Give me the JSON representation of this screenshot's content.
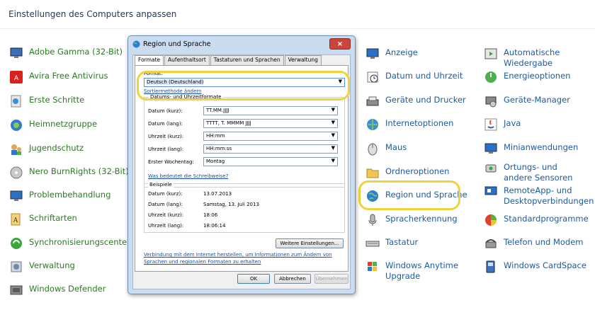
{
  "page_title": "Einstellungen des Computers anpassen",
  "left_column": [
    {
      "label": "Adobe Gamma (32-Bit)",
      "icon": "adobe-gamma-icon",
      "color": "green"
    },
    {
      "label": "Avira Free Antivirus",
      "icon": "avira-icon",
      "color": "green"
    },
    {
      "label": "Erste Schritte",
      "icon": "getting-started-icon",
      "color": "green"
    },
    {
      "label": "Heimnetzgruppe",
      "icon": "homegroup-icon",
      "color": "green"
    },
    {
      "label": "Jugendschutz",
      "icon": "parental-control-icon",
      "color": "green"
    },
    {
      "label": "Nero BurnRights (32-Bit)",
      "icon": "nero-icon",
      "color": "green"
    },
    {
      "label": "Problembehandlung",
      "icon": "troubleshooting-icon",
      "color": "green"
    },
    {
      "label": "Schriftarten",
      "icon": "fonts-icon",
      "color": "green"
    },
    {
      "label": "Synchronisierungscenter",
      "icon": "sync-center-icon",
      "color": "green"
    },
    {
      "label": "Verwaltung",
      "icon": "administration-icon",
      "color": "green"
    },
    {
      "label": "Windows Defender",
      "icon": "windows-defender-icon",
      "color": "green"
    }
  ],
  "middle_column": [
    {
      "label": "Anzeige",
      "icon": "display-icon"
    },
    {
      "label": "Datum und Uhrzeit",
      "icon": "date-time-icon"
    },
    {
      "label": "Geräte und Drucker",
      "icon": "devices-printers-icon"
    },
    {
      "label": "Internetoptionen",
      "icon": "internet-options-icon"
    },
    {
      "label": "Maus",
      "icon": "mouse-icon"
    },
    {
      "label": "Ordneroptionen",
      "icon": "folder-options-icon"
    },
    {
      "label": "Region und Sprache",
      "icon": "region-language-icon"
    },
    {
      "label": "Spracherkennung",
      "icon": "speech-recognition-icon"
    },
    {
      "label": "Tastatur",
      "icon": "keyboard-icon"
    },
    {
      "label": "Windows Anytime Upgrade",
      "icon": "windows-anytime-upgrade-icon"
    }
  ],
  "right_column": [
    {
      "label": "Automatische Wiedergabe",
      "icon": "autoplay-icon"
    },
    {
      "label": "Energieoptionen",
      "icon": "power-options-icon"
    },
    {
      "label": "Geräte-Manager",
      "icon": "device-manager-icon"
    },
    {
      "label": "Java",
      "icon": "java-icon"
    },
    {
      "label": "Minianwendungen",
      "icon": "gadgets-icon"
    },
    {
      "label": "Ortungs- und andere Sensoren",
      "icon": "sensors-icon"
    },
    {
      "label": "RemoteApp- und Desktopverbindungen",
      "icon": "remoteapp-icon"
    },
    {
      "label": "Standardprogramme",
      "icon": "default-programs-icon"
    },
    {
      "label": "Telefon und Modem",
      "icon": "phone-modem-icon"
    },
    {
      "label": "Windows CardSpace",
      "icon": "cardspace-icon"
    }
  ],
  "dialog": {
    "title": "Region und Sprache",
    "close_glyph": "×",
    "tabs": [
      "Formate",
      "Aufenthaltsort",
      "Tastaturen und Sprachen",
      "Verwaltung"
    ],
    "format_label": "Format:",
    "format_value": "Deutsch (Deutschland)",
    "sort_link": "Sortiermethode ändern",
    "group_title": "Datums- und Uhrzeitformate",
    "fields": [
      {
        "label": "Datum (kurz):",
        "value": "TT.MM.JJJJ"
      },
      {
        "label": "Datum (lang):",
        "value": "TTTT, T. MMMM JJJJ"
      },
      {
        "label": "Uhrzeit (kurz):",
        "value": "HH:mm"
      },
      {
        "label": "Uhrzeit (lang):",
        "value": "HH:mm:ss"
      },
      {
        "label": "Erster Wochentag:",
        "value": "Montag"
      }
    ],
    "notation_link": "Was bedeutet die Schreibweise?",
    "examples_title": "Beispiele",
    "examples": [
      {
        "label": "Datum (kurz):",
        "value": "13.07.2013"
      },
      {
        "label": "Datum (lang):",
        "value": "Samstag, 13. Juli 2013"
      },
      {
        "label": "Uhrzeit (kurz):",
        "value": "18:06"
      },
      {
        "label": "Uhrzeit (lang):",
        "value": "18:06:14"
      }
    ],
    "more_settings_button": "Weitere Einstellungen...",
    "info_link": "Verbindung mit dem Internet herstellen, um Informationen zum Ändern von Sprachen und regionalen Formaten zu erhalten",
    "ok_button": "OK",
    "cancel_button": "Abbrechen",
    "apply_button": "Übernehmen"
  },
  "colors": {
    "highlight": "#f2d23a",
    "link_blue": "#1e5aa0",
    "link_green": "#2c7a23"
  }
}
